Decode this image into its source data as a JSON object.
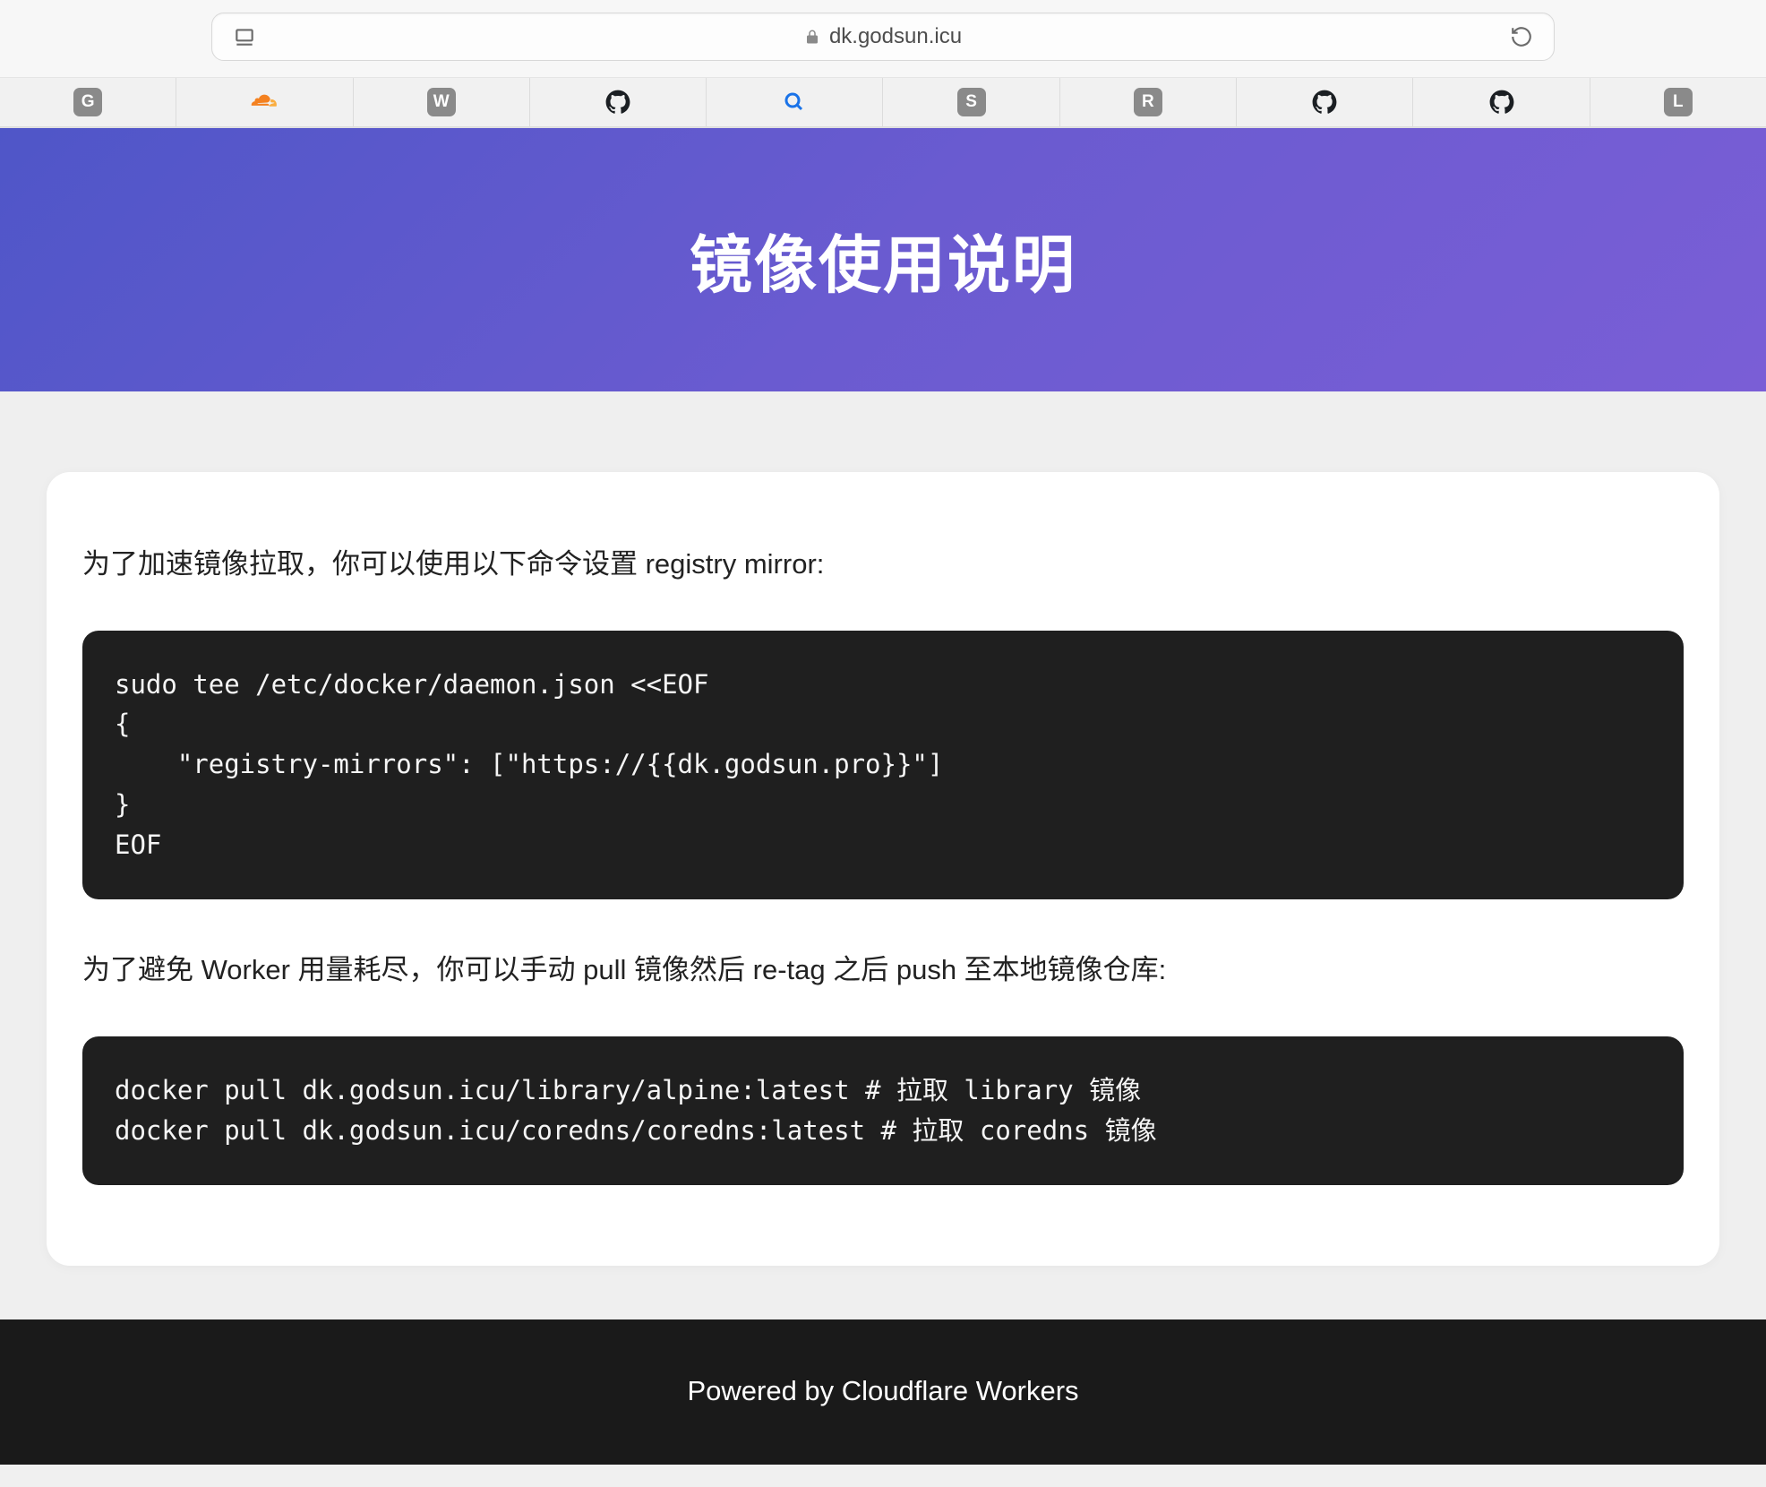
{
  "browser": {
    "url": "dk.godsun.icu",
    "tabs": [
      {
        "type": "badge",
        "letter": "G"
      },
      {
        "type": "cloudflare"
      },
      {
        "type": "badge",
        "letter": "W"
      },
      {
        "type": "github"
      },
      {
        "type": "search"
      },
      {
        "type": "badge",
        "letter": "S"
      },
      {
        "type": "badge",
        "letter": "R"
      },
      {
        "type": "github"
      },
      {
        "type": "github"
      },
      {
        "type": "badge",
        "letter": "L"
      }
    ]
  },
  "header": {
    "title": "镜像使用说明"
  },
  "content": {
    "para1": "为了加速镜像拉取，你可以使用以下命令设置 registry mirror:",
    "code1": "sudo tee /etc/docker/daemon.json <<EOF\n{\n    \"registry-mirrors\": [\"https://{{dk.godsun.pro}}\"]\n}\nEOF",
    "para2": "为了避免 Worker 用量耗尽，你可以手动 pull 镜像然后 re-tag 之后 push 至本地镜像仓库:",
    "code2": "docker pull dk.godsun.icu/library/alpine:latest # 拉取 library 镜像\ndocker pull dk.godsun.icu/coredns/coredns:latest # 拉取 coredns 镜像"
  },
  "footer": {
    "text": "Powered by Cloudflare Workers"
  }
}
